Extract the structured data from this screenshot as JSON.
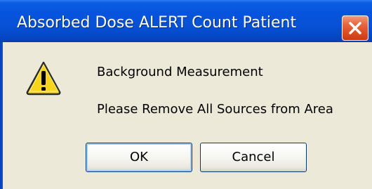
{
  "dialog": {
    "title": "Absorbed Dose ALERT  Count Patient",
    "message_line1": "Background Measurement",
    "message_line2": "Please Remove All Sources from Area",
    "ok_label": "OK",
    "cancel_label": "Cancel",
    "icon": "warning-icon",
    "close_icon": "close-icon"
  },
  "colors": {
    "titlebar": "#0654de",
    "dialog_bg": "#ece9d8",
    "close_button": "#d94a1f",
    "warning_fill": "#f7d51c"
  }
}
